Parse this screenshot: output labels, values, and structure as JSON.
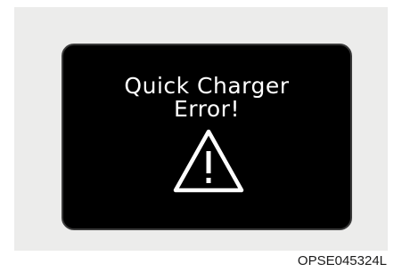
{
  "display": {
    "message_line1": "Quick Charger",
    "message_line2": "Error!",
    "icon": "warning-triangle-icon"
  },
  "figure_code": "OPSE045324L",
  "colors": {
    "panel_background": "#ececeb",
    "screen_background": "#000000",
    "screen_text": "#ffffff"
  }
}
